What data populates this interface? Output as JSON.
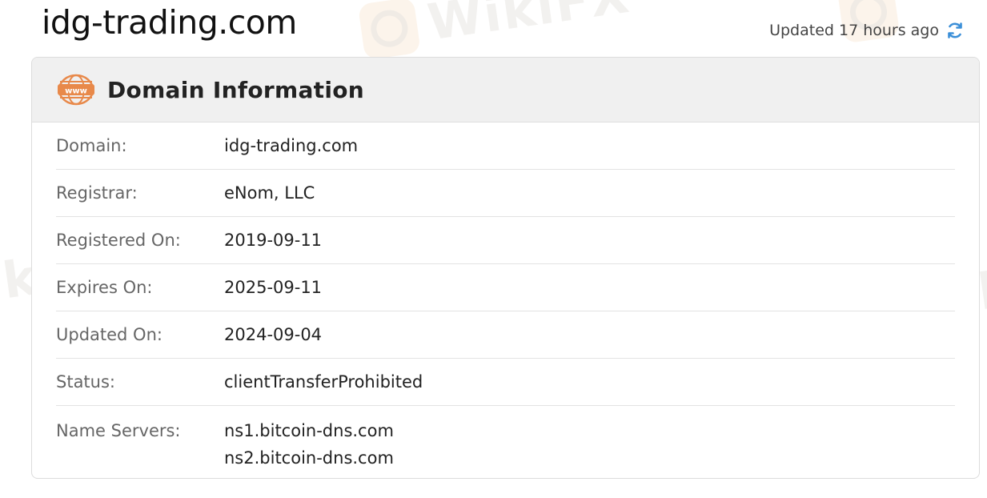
{
  "site_title": "idg-trading.com",
  "updated_text": "Updated 17 hours ago",
  "watermark_text": "WikiFX",
  "card": {
    "title": "Domain Information",
    "rows": [
      {
        "label": "Domain:",
        "value": "idg-trading.com"
      },
      {
        "label": "Registrar:",
        "value": "eNom, LLC"
      },
      {
        "label": "Registered On:",
        "value": "2019-09-11"
      },
      {
        "label": "Expires On:",
        "value": "2025-09-11"
      },
      {
        "label": "Updated On:",
        "value": "2024-09-04"
      },
      {
        "label": "Status:",
        "value": "clientTransferProhibited"
      }
    ],
    "name_servers": {
      "label": "Name Servers:",
      "values": [
        "ns1.bitcoin-dns.com",
        "ns2.bitcoin-dns.com"
      ]
    }
  },
  "colors": {
    "accent_icon": "#e8894a",
    "refresh_icon": "#3b8fd8",
    "header_bg": "#f0f0f0"
  },
  "icons": {
    "header": "www-globe-icon",
    "refresh": "refresh-icon"
  }
}
